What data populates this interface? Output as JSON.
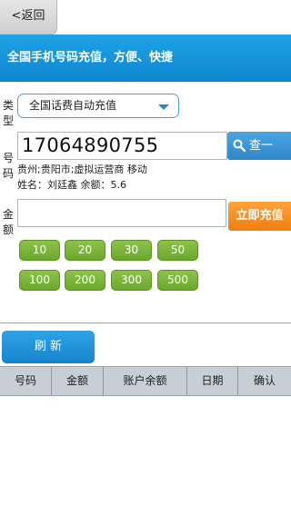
{
  "topbar": {
    "back_label": "<返回"
  },
  "banner": {
    "title": "全国手机号码充值，方便、快捷"
  },
  "form": {
    "type_label": [
      "类",
      "型"
    ],
    "type_select_value": "全国话费自动充值",
    "number_label": [
      "号",
      "码"
    ],
    "phone_number": "17064890755",
    "query_label": "查一",
    "location_info": "贵州;贵阳市;虚拟运营商 移动",
    "owner_info": "姓名：刘廷鑫 余额：5.6",
    "amount_label": [
      "金",
      "额"
    ],
    "amount_value": "",
    "pay_label": "立即充值",
    "amount_options": [
      "10",
      "20",
      "30",
      "50",
      "100",
      "200",
      "300",
      "500"
    ]
  },
  "refresh_label": "刷 新",
  "table": {
    "headers": [
      "号码",
      "金额",
      "账户余额",
      "日期",
      "确认"
    ]
  },
  "colors": {
    "banner": "#1496db",
    "pay_button": "#f5891e",
    "amount_chip": "#7cb63a",
    "refresh_button": "#1e93da"
  }
}
